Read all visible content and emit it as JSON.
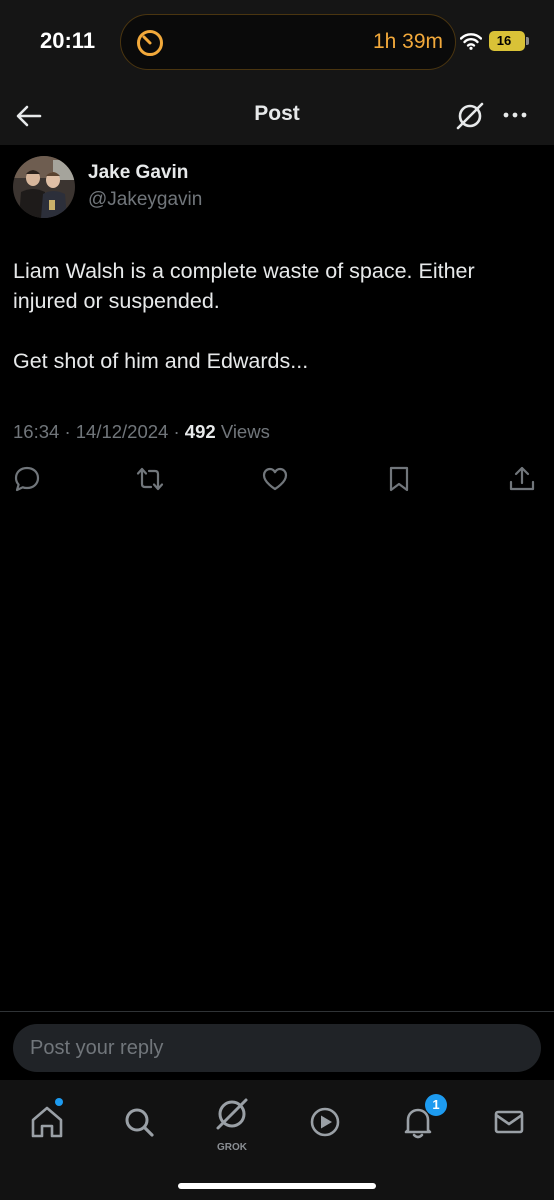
{
  "status_bar": {
    "time": "20:11",
    "timer": "1h 39m",
    "battery": "16",
    "timer_color": "#f2a93b",
    "battery_color": "#d9c237"
  },
  "header": {
    "title": "Post",
    "back_icon": "arrow-left-icon",
    "grok_icon": "grok-icon",
    "more_icon": "more-horizontal-icon"
  },
  "post": {
    "author_name": "Jake Gavin",
    "author_handle": "@Jakeygavin",
    "text": "Liam Walsh is a complete waste of space. Either injured or suspended.\n\nGet shot of him and Edwards...",
    "time": "16:34",
    "date": "14/12/2024",
    "views_count": "492",
    "views_label": "Views",
    "separator": "·"
  },
  "actions": [
    "reply-icon",
    "repost-icon",
    "like-icon",
    "bookmark-icon",
    "share-icon"
  ],
  "reply": {
    "placeholder": "Post your reply"
  },
  "tab_bar": {
    "tabs": [
      "home-icon",
      "search-icon",
      "grok-icon",
      "video-icon",
      "notifications-icon",
      "messages-icon"
    ],
    "grok_label": "GROK",
    "notification_badge": "1",
    "accent": "#1d9bf0"
  }
}
